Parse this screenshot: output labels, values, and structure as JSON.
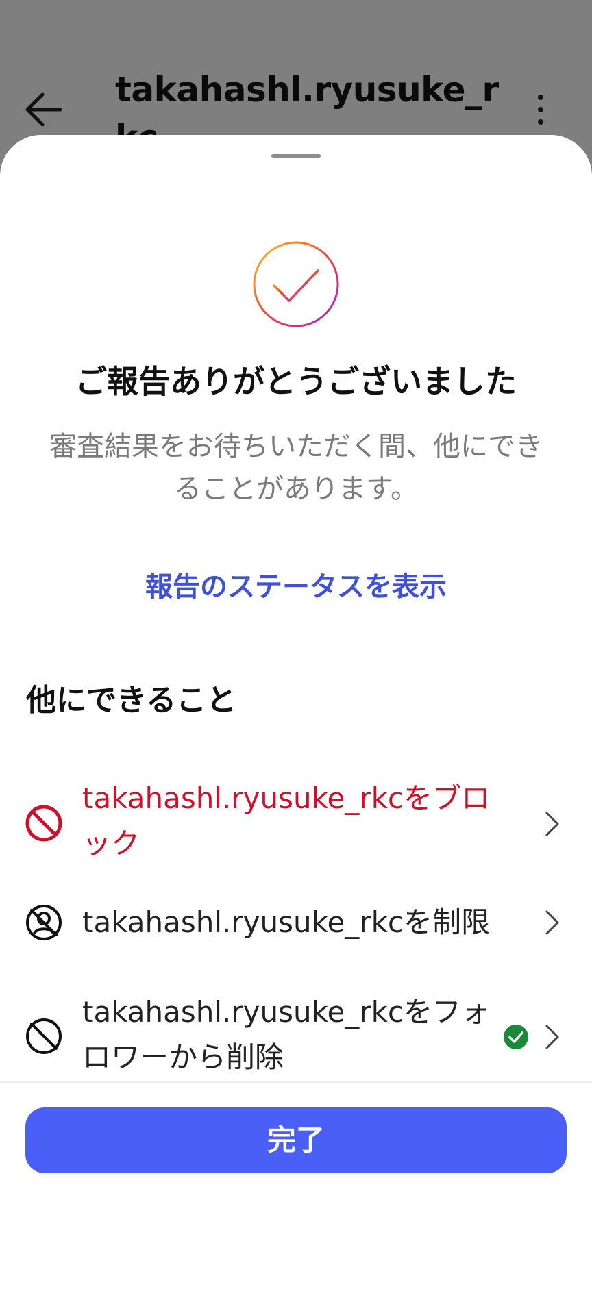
{
  "background": {
    "title": "takahashl.ryusuke_rkc"
  },
  "sheet": {
    "headline": "ご報告ありがとうございました",
    "subtext": "審査結果をお待ちいただく間、他にできることがあります。",
    "status_link": "報告のステータスを表示",
    "section_title": "他にできること",
    "actions": [
      {
        "label": "takahashl.ryusuke_rkcをブロック",
        "icon": "block-icon",
        "color": "#d0102a"
      },
      {
        "label": "takahashl.ryusuke_rkcを制限",
        "icon": "restrict-icon"
      },
      {
        "label": "takahashl.ryusuke_rkcをフォロワーから削除",
        "icon": "remove-follower-icon",
        "status": "completed"
      }
    ],
    "done_label": "完了"
  },
  "colors": {
    "accent": "#4a5ff5",
    "link": "#3f51d6",
    "danger": "#d0102a",
    "success": "#1a8a3a",
    "overlay": "#7f7f7f"
  }
}
